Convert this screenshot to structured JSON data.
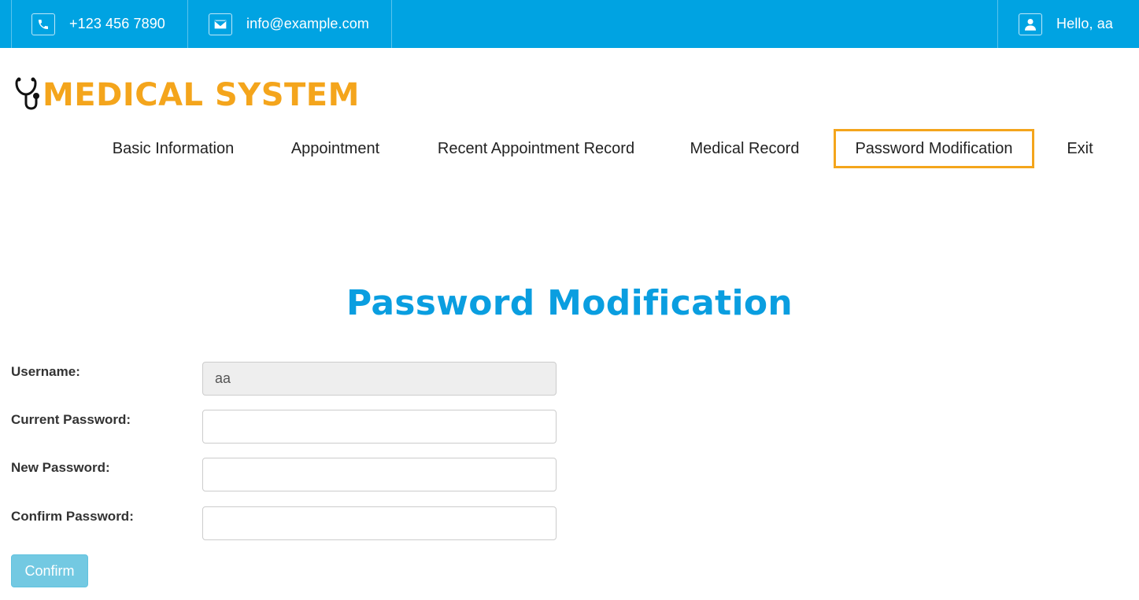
{
  "topbar": {
    "phone": {
      "icon": "phone-icon",
      "text": "+123 456 7890"
    },
    "email": {
      "icon": "envelope-icon",
      "text": "info@example.com"
    },
    "user": {
      "icon": "user-icon",
      "text": "Hello, aa"
    },
    "background": "#00a3e2"
  },
  "logo": {
    "icon": "stethoscope-icon",
    "text": "MEDICAL SYSTEM",
    "color": "#f4a51c"
  },
  "nav": {
    "items": [
      {
        "label": "Basic Information"
      },
      {
        "label": "Appointment"
      },
      {
        "label": "Recent Appointment Record"
      },
      {
        "label": "Medical Record"
      },
      {
        "label": "Password Modification",
        "active": true
      },
      {
        "label": "Exit"
      }
    ],
    "active_color": "#f4a51c"
  },
  "page": {
    "title": "Password Modification",
    "title_color": "#0a9ee0"
  },
  "form": {
    "username": {
      "label": "Username:",
      "value": "aa",
      "readonly": true
    },
    "current_password": {
      "label": "Current Password:",
      "value": ""
    },
    "new_password": {
      "label": "New Password:",
      "value": ""
    },
    "confirm_password": {
      "label": "Confirm Password:",
      "value": ""
    },
    "submit_label": "Confirm",
    "submit_color": "#5bc0de"
  }
}
